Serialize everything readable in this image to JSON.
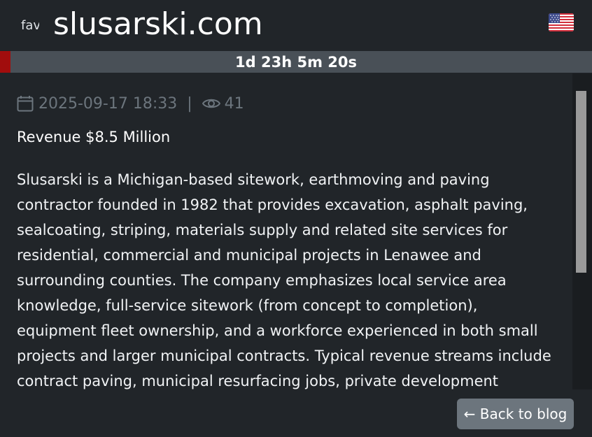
{
  "header": {
    "favicon_alt": "favicon",
    "site_title": "slusarski.com",
    "flag_icon": "us-flag-icon"
  },
  "countdown": {
    "text": "1d 23h 5m 20s",
    "progress_fraction": 0.018,
    "fill_color": "#a10d0d"
  },
  "meta": {
    "date": "2025-09-17 18:33",
    "separator": "|",
    "views": "41",
    "date_icon": "calendar-icon",
    "views_icon": "eye-icon"
  },
  "article": {
    "revenue": "Revenue $8.5 Million",
    "description": "Slusarski is a Michigan-based sitework, earthmoving and paving contractor founded in 1982 that provides excavation, asphalt paving, sealcoating, striping, materials supply and related site services for residential, commercial and municipal projects in Lenawee and surrounding counties. The company emphasizes local service area knowledge, full-service sitework (from concept to completion), equipment fleet ownership, and a workforce experienced in both small projects and larger municipal contracts. Typical revenue streams include contract paving, municipal resurfacing jobs, private development"
  },
  "footer": {
    "back_label": "← Back to blog"
  }
}
